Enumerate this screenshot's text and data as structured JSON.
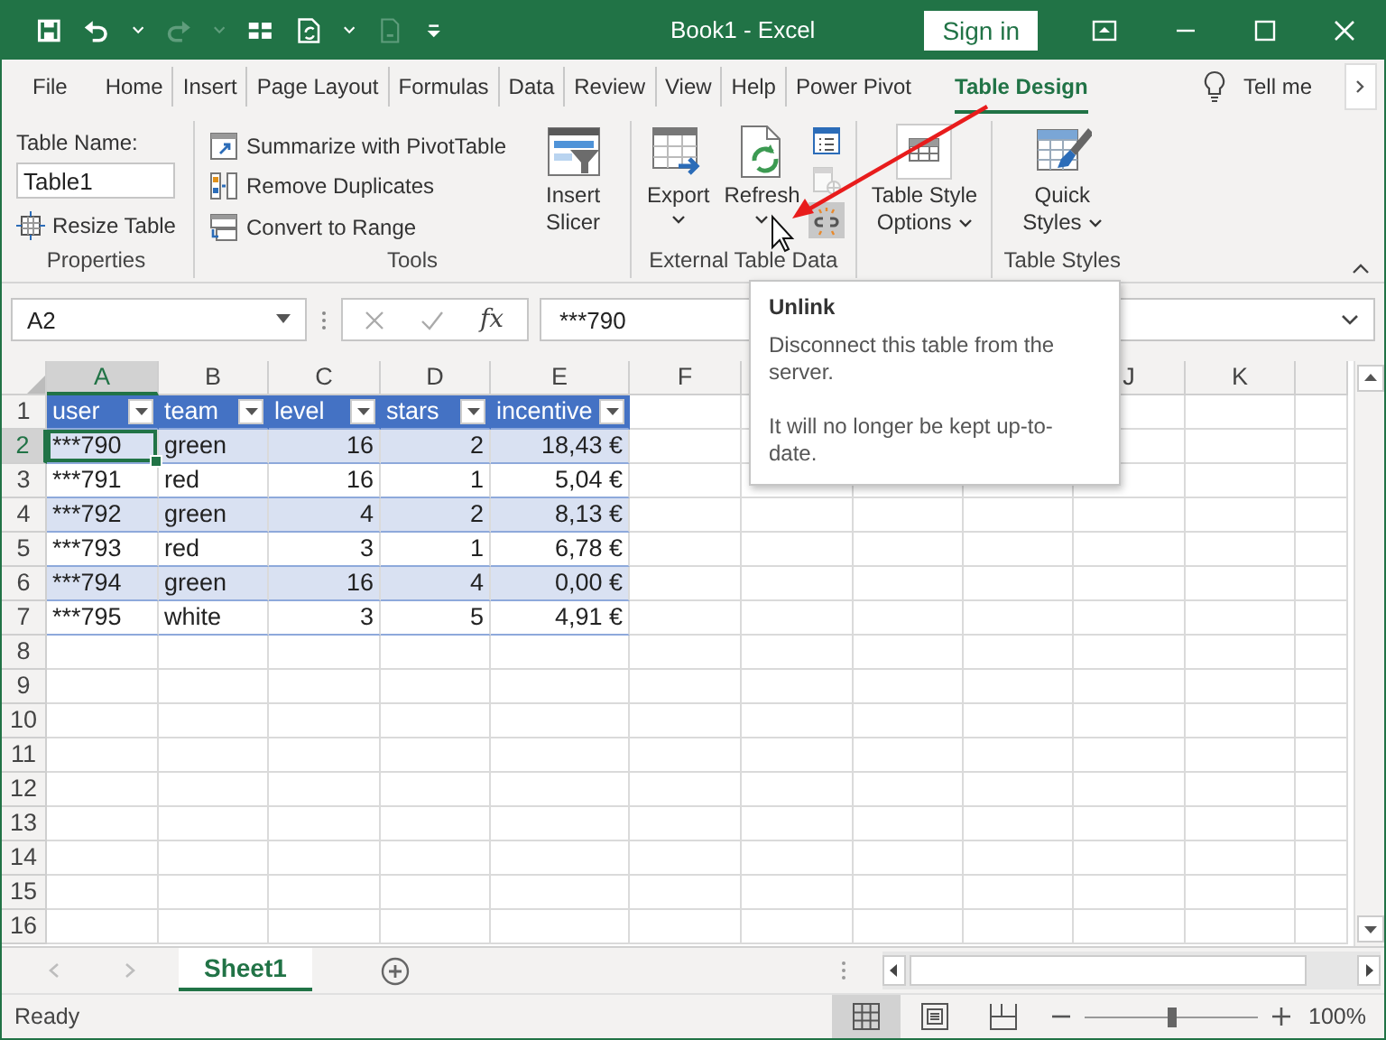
{
  "window": {
    "title": "Book1 - Excel",
    "sign_in": "Sign in"
  },
  "quick_access": [
    {
      "kind": "save",
      "disabled": false
    },
    {
      "kind": "undo",
      "disabled": false
    },
    {
      "kind": "redo",
      "disabled": true
    },
    {
      "kind": "form",
      "disabled": false
    },
    {
      "kind": "refresh_all",
      "disabled": false
    },
    {
      "kind": "unlink",
      "disabled": true
    },
    {
      "kind": "customize",
      "disabled": false
    }
  ],
  "tabs": [
    {
      "label": "File",
      "selected": false
    },
    {
      "label": "Home",
      "selected": false
    },
    {
      "label": "Insert",
      "selected": false
    },
    {
      "label": "Page Layout",
      "selected": false
    },
    {
      "label": "Formulas",
      "selected": false
    },
    {
      "label": "Data",
      "selected": false
    },
    {
      "label": "Review",
      "selected": false
    },
    {
      "label": "View",
      "selected": false
    },
    {
      "label": "Help",
      "selected": false
    },
    {
      "label": "Power Pivot",
      "selected": false
    },
    {
      "label": "Table Design",
      "selected": true
    }
  ],
  "tell_me": "Tell me",
  "ribbon": {
    "properties": {
      "name_label": "Table Name:",
      "name_value": "Table1",
      "resize": "Resize Table",
      "label": "Properties"
    },
    "tools": {
      "commands": [
        {
          "kind": "pivot",
          "label": "Summarize with PivotTable"
        },
        {
          "kind": "duplicates",
          "label": "Remove Duplicates"
        },
        {
          "kind": "range",
          "label": "Convert to Range"
        }
      ],
      "slicer": "Insert Slicer",
      "label": "Tools"
    },
    "external": {
      "export": "Export",
      "refresh": "Refresh",
      "small": [
        {
          "kind": "properties",
          "disabled": false,
          "hovered": false
        },
        {
          "kind": "browser",
          "disabled": true,
          "hovered": false
        },
        {
          "kind": "unlink",
          "disabled": false,
          "hovered": true
        }
      ],
      "label": "External Table Data"
    },
    "style_options": {
      "button": "Table Style Options"
    },
    "styles": {
      "quick": "Quick Styles",
      "label": "Table Styles"
    }
  },
  "formula_bar": {
    "name_box": "A2",
    "insert_function": "fx",
    "formula": "***790"
  },
  "columns": [
    {
      "label": "A",
      "selected": true
    },
    {
      "label": "B",
      "selected": false
    },
    {
      "label": "C",
      "selected": false
    },
    {
      "label": "D",
      "selected": false
    },
    {
      "label": "E",
      "selected": false
    },
    {
      "label": "F",
      "selected": false
    },
    {
      "label": "J",
      "selected": false
    },
    {
      "label": "K",
      "selected": false
    }
  ],
  "row_headers": [
    {
      "label": "1",
      "selected": false
    },
    {
      "label": "2",
      "selected": true
    },
    {
      "label": "3",
      "selected": false
    },
    {
      "label": "4",
      "selected": false
    },
    {
      "label": "5",
      "selected": false
    },
    {
      "label": "6",
      "selected": false
    },
    {
      "label": "7",
      "selected": false
    },
    {
      "label": "8",
      "selected": false
    },
    {
      "label": "9",
      "selected": false
    },
    {
      "label": "10",
      "selected": false
    },
    {
      "label": "11",
      "selected": false
    },
    {
      "label": "12",
      "selected": false
    },
    {
      "label": "13",
      "selected": false
    },
    {
      "label": "14",
      "selected": false
    },
    {
      "label": "15",
      "selected": false
    },
    {
      "label": "16",
      "selected": false
    }
  ],
  "table": {
    "columns": [
      {
        "label": "user",
        "numeric": false
      },
      {
        "label": "team",
        "numeric": false
      },
      {
        "label": "level",
        "numeric": true
      },
      {
        "label": "stars",
        "numeric": true
      },
      {
        "label": "incentive",
        "numeric": true
      }
    ],
    "rows": [
      {
        "cells": [
          "***790",
          "green",
          "16",
          "2",
          "18,43 €"
        ],
        "active": true
      },
      {
        "cells": [
          "***791",
          "red",
          "16",
          "1",
          "5,04 €"
        ],
        "active": false
      },
      {
        "cells": [
          "***792",
          "green",
          "4",
          "2",
          "8,13 €"
        ],
        "active": false
      },
      {
        "cells": [
          "***793",
          "red",
          "3",
          "1",
          "6,78 €"
        ],
        "active": false
      },
      {
        "cells": [
          "***794",
          "green",
          "16",
          "4",
          "0,00 €"
        ],
        "active": false
      },
      {
        "cells": [
          "***795",
          "white",
          "3",
          "5",
          "4,91 €"
        ],
        "active": false
      }
    ]
  },
  "sheet_navigation": {
    "disabled": true
  },
  "sheets": [
    {
      "label": "Sheet1",
      "selected": true
    }
  ],
  "status": {
    "text": "Ready",
    "views": [
      {
        "kind": "normal",
        "selected": true
      },
      {
        "kind": "page_layout",
        "selected": false
      },
      {
        "kind": "page_break",
        "selected": false
      }
    ],
    "zoom": {
      "level": 0.5,
      "reading": "100%"
    }
  },
  "tooltip": {
    "title": "Unlink",
    "description": "Disconnect this table from the server.",
    "note": "It will no longer be kept up-to-date."
  }
}
